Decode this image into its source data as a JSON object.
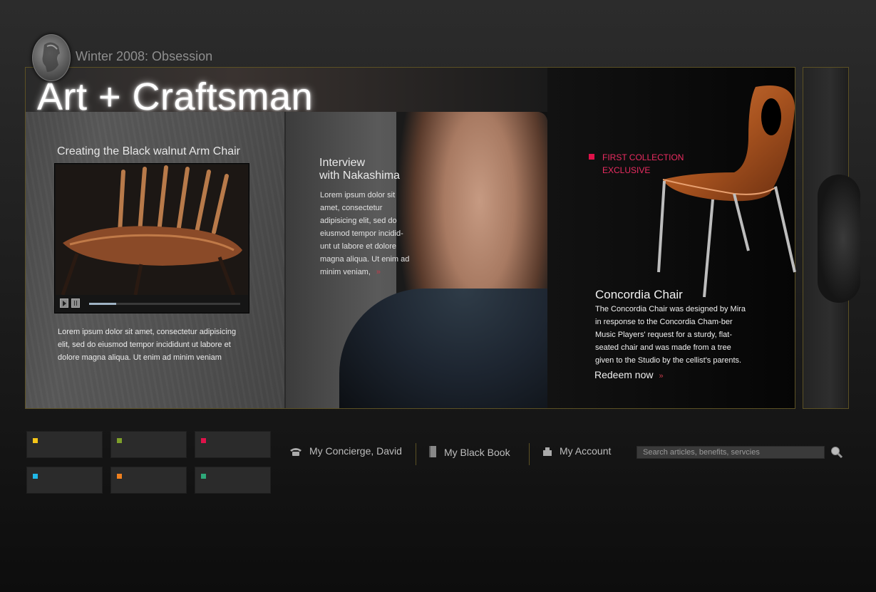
{
  "header": {
    "issue": "Winter 2008: Obsession",
    "title": "Art + Craftsman"
  },
  "video_panel": {
    "title": "Creating the Black walnut Arm Chair",
    "progress_percent": 18,
    "text": "Lorem ipsum dolor sit amet, consectetur adipisicing elit, sed do eiusmod tempor incididunt ut labore et dolore magna aliqua. Ut enim ad minim veniam"
  },
  "interview": {
    "title_line1": "Interview",
    "title_line2": "with Nakashima",
    "text": "Lorem ipsum dolor sit amet, consectetur adipisicing elit, sed do eiusmod tempor incidid-unt ut labore et dolore magna aliqua. Ut enim ad minim veniam,",
    "more_arrows": "»"
  },
  "feature": {
    "collection_line1": "FIRST COLLECTION",
    "collection_line2": "EXCLUSIVE",
    "chair_name": "Concordia Chair",
    "chair_text": "The Concordia Chair was designed by Mira in response to the Concordia Cham-ber Music Players' request for a sturdy, flat-seated chair and was made from a tree given to the Studio by the cellist's parents.",
    "redeem_label": "Redeem now",
    "redeem_arrows": "»"
  },
  "tiles": [
    {
      "color": "#f5c518"
    },
    {
      "color": "#7ea02a"
    },
    {
      "color": "#e0124a"
    },
    {
      "color": "#1fb8e8"
    },
    {
      "color": "#f0801e"
    },
    {
      "color": "#2ea97a"
    }
  ],
  "nav": {
    "concierge_label": "My Concierge, David",
    "black_book_label": "My Black Book",
    "account_label": "My Account"
  },
  "search": {
    "placeholder": "Search articles, benefits, servcies"
  },
  "colors": {
    "frame_border": "#5c5124",
    "accent_pink": "#e0124a"
  }
}
